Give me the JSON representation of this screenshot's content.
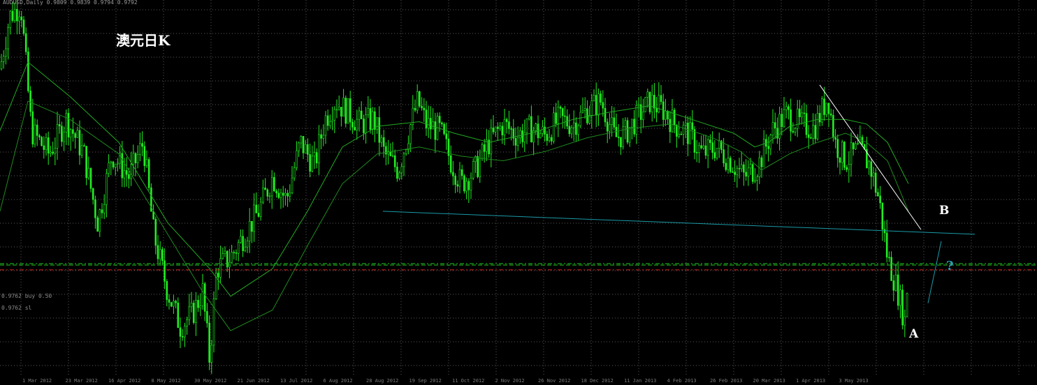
{
  "window": {
    "header": "AUDUSD,Daily  0.9809 0.9839 0.9794 0.9792",
    "title": "澳元日K"
  },
  "annotations": {
    "a": "A",
    "b": "B",
    "question": "?"
  },
  "order_lines": {
    "buy_label": "0.9762 buy 0.50",
    "sl_label": "0.9762 sl"
  },
  "colors": {
    "background": "#000000",
    "candles": "#22ee22",
    "ma_fast": "#22aa22",
    "ma_slow": "#1f8a1f",
    "grid": "#5a5a5a",
    "neckline": "#1a9aa8",
    "trendline": "#ffffff",
    "order_line": "#22cc22",
    "sl_line": "#dd2222"
  },
  "chart_data": {
    "type": "candlestick",
    "symbol": "AUDUSD",
    "timeframe": "Daily",
    "x_labels": [
      "1 Mar 2012",
      "23 Mar 2012",
      "16 Apr 2012",
      "8 May 2012",
      "30 May 2012",
      "21 Jun 2012",
      "13 Jul 2012",
      "6 Aug 2012",
      "28 Aug 2012",
      "19 Sep 2012",
      "11 Oct 2012",
      "2 Nov 2012",
      "26 Nov 2012",
      "18 Dec 2012",
      "11 Jan 2013",
      "4 Feb 2013",
      "26 Feb 2013",
      "20 Mar 2013",
      "1 Apr 2013",
      "3 May 2013"
    ],
    "close_path": [
      [
        0,
        1.062
      ],
      [
        14,
        1.085
      ],
      [
        30,
        1.09
      ],
      [
        45,
        1.035
      ],
      [
        70,
        1.025
      ],
      [
        95,
        1.04
      ],
      [
        120,
        1.025
      ],
      [
        140,
        0.995
      ],
      [
        160,
        1.025
      ],
      [
        185,
        1.015
      ],
      [
        205,
        1.03
      ],
      [
        220,
        0.99
      ],
      [
        240,
        0.965
      ],
      [
        258,
        0.95
      ],
      [
        275,
        0.955
      ],
      [
        290,
        0.965
      ],
      [
        300,
        0.935
      ],
      [
        310,
        0.975
      ],
      [
        330,
        0.98
      ],
      [
        350,
        0.99
      ],
      [
        370,
        1.0
      ],
      [
        390,
        1.015
      ],
      [
        410,
        1.005
      ],
      [
        430,
        1.03
      ],
      [
        450,
        1.02
      ],
      [
        465,
        1.04
      ],
      [
        480,
        1.048
      ],
      [
        495,
        1.044
      ],
      [
        515,
        1.038
      ],
      [
        535,
        1.04
      ],
      [
        550,
        1.025
      ],
      [
        570,
        1.018
      ],
      [
        585,
        1.035
      ],
      [
        598,
        1.048
      ],
      [
        610,
        1.038
      ],
      [
        630,
        1.035
      ],
      [
        645,
        1.022
      ],
      [
        660,
        1.012
      ],
      [
        680,
        1.018
      ],
      [
        700,
        1.03
      ],
      [
        720,
        1.038
      ],
      [
        740,
        1.033
      ],
      [
        760,
        1.036
      ],
      [
        780,
        1.033
      ],
      [
        800,
        1.04
      ],
      [
        820,
        1.038
      ],
      [
        840,
        1.044
      ],
      [
        860,
        1.048
      ],
      [
        880,
        1.032
      ],
      [
        895,
        1.034
      ],
      [
        910,
        1.04
      ],
      [
        930,
        1.048
      ],
      [
        950,
        1.044
      ],
      [
        965,
        1.038
      ],
      [
        985,
        1.034
      ],
      [
        1005,
        1.025
      ],
      [
        1025,
        1.028
      ],
      [
        1045,
        1.022
      ],
      [
        1065,
        1.015
      ],
      [
        1085,
        1.02
      ],
      [
        1105,
        1.035
      ],
      [
        1125,
        1.042
      ],
      [
        1145,
        1.038
      ],
      [
        1165,
        1.036
      ],
      [
        1185,
        1.05
      ],
      [
        1195,
        1.03
      ],
      [
        1210,
        1.022
      ],
      [
        1230,
        1.027
      ],
      [
        1245,
        1.02
      ],
      [
        1258,
        1.005
      ],
      [
        1270,
        0.98
      ],
      [
        1285,
        0.965
      ],
      [
        1295,
        0.952
      ],
      [
        1300,
        0.9762
      ]
    ],
    "ma_fast_path": [
      [
        0,
        1.035
      ],
      [
        40,
        1.065
      ],
      [
        100,
        1.05
      ],
      [
        170,
        1.03
      ],
      [
        240,
        0.995
      ],
      [
        300,
        0.975
      ],
      [
        330,
        0.963
      ],
      [
        390,
        0.975
      ],
      [
        440,
        1.0
      ],
      [
        490,
        1.028
      ],
      [
        540,
        1.037
      ],
      [
        600,
        1.039
      ],
      [
        650,
        1.034
      ],
      [
        700,
        1.03
      ],
      [
        760,
        1.034
      ],
      [
        820,
        1.04
      ],
      [
        870,
        1.043
      ],
      [
        930,
        1.046
      ],
      [
        990,
        1.04
      ],
      [
        1050,
        1.034
      ],
      [
        1080,
        1.028
      ],
      [
        1100,
        1.03
      ],
      [
        1130,
        1.037
      ],
      [
        1170,
        1.04
      ],
      [
        1210,
        1.04
      ],
      [
        1240,
        1.038
      ],
      [
        1270,
        1.03
      ],
      [
        1300,
        1.012
      ]
    ],
    "ma_slow_path": [
      [
        0,
        1.0
      ],
      [
        40,
        1.048
      ],
      [
        100,
        1.04
      ],
      [
        170,
        1.025
      ],
      [
        230,
        0.995
      ],
      [
        290,
        0.965
      ],
      [
        330,
        0.948
      ],
      [
        390,
        0.957
      ],
      [
        440,
        0.985
      ],
      [
        490,
        1.012
      ],
      [
        540,
        1.025
      ],
      [
        600,
        1.028
      ],
      [
        660,
        1.024
      ],
      [
        720,
        1.022
      ],
      [
        780,
        1.026
      ],
      [
        840,
        1.032
      ],
      [
        900,
        1.036
      ],
      [
        960,
        1.038
      ],
      [
        1020,
        1.032
      ],
      [
        1060,
        1.026
      ],
      [
        1090,
        1.018
      ],
      [
        1130,
        1.025
      ],
      [
        1170,
        1.03
      ],
      [
        1210,
        1.034
      ],
      [
        1240,
        1.03
      ],
      [
        1270,
        1.022
      ],
      [
        1300,
        1.0
      ]
    ],
    "neckline": {
      "from": [
        548,
        1.0
      ],
      "to": [
        1395,
        0.99
      ]
    },
    "trendline": {
      "from": [
        1173,
        1.055
      ],
      "to": [
        1318,
        0.992
      ]
    },
    "projection": {
      "from": [
        1328,
        0.96
      ],
      "to": [
        1347,
        0.987
      ]
    },
    "order_lines": {
      "buy_a": 0.9772,
      "buy_b": 0.9766,
      "sl": 0.9745
    },
    "ylim": [
      0.928,
      1.092
    ]
  }
}
